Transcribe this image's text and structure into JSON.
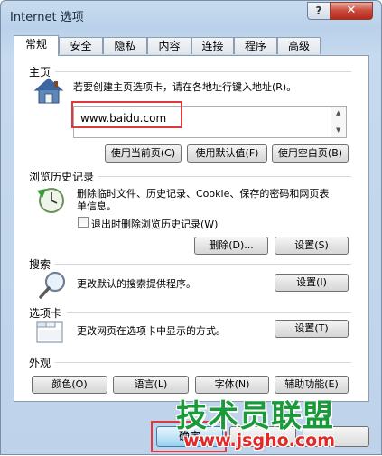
{
  "window": {
    "title": "Internet 选项",
    "help_label": "?",
    "close_label": "✕"
  },
  "tabs": [
    {
      "label": "常规",
      "active": true
    },
    {
      "label": "安全",
      "active": false
    },
    {
      "label": "隐私",
      "active": false
    },
    {
      "label": "内容",
      "active": false
    },
    {
      "label": "连接",
      "active": false
    },
    {
      "label": "程序",
      "active": false
    },
    {
      "label": "高级",
      "active": false
    }
  ],
  "homepage": {
    "label": "主页",
    "description": "若要创建主页选项卡，请在各地址行键入地址(R)。",
    "url": "www.baidu.com",
    "use_current": "使用当前页(C)",
    "use_default": "使用默认值(F)",
    "use_blank": "使用空白页(B)"
  },
  "history": {
    "label": "浏览历史记录",
    "description": "删除临时文件、历史记录、Cookie、保存的密码和网页表单信息。",
    "checkbox_label": "退出时删除浏览历史记录(W)",
    "checked": false,
    "delete_button": "删除(D)...",
    "settings_button": "设置(S)"
  },
  "search": {
    "label": "搜索",
    "description": "更改默认的搜索提供程序。",
    "settings_button": "设置(I)"
  },
  "tabs_section": {
    "label": "选项卡",
    "description": "更改网页在选项卡中显示的方式。",
    "settings_button": "设置(T)"
  },
  "appearance": {
    "label": "外观",
    "colors_button": "颜色(O)",
    "languages_button": "语言(L)",
    "fonts_button": "字体(N)",
    "accessibility_button": "辅助功能(E)"
  },
  "footer": {
    "ok_button": "确定"
  },
  "watermark": {
    "title": "技术员联盟",
    "url": "www.jsgho.com"
  },
  "colors": {
    "highlight": "#e0393b",
    "watermark_green": "#1a9a3a",
    "watermark_red": "#e02a2a"
  }
}
